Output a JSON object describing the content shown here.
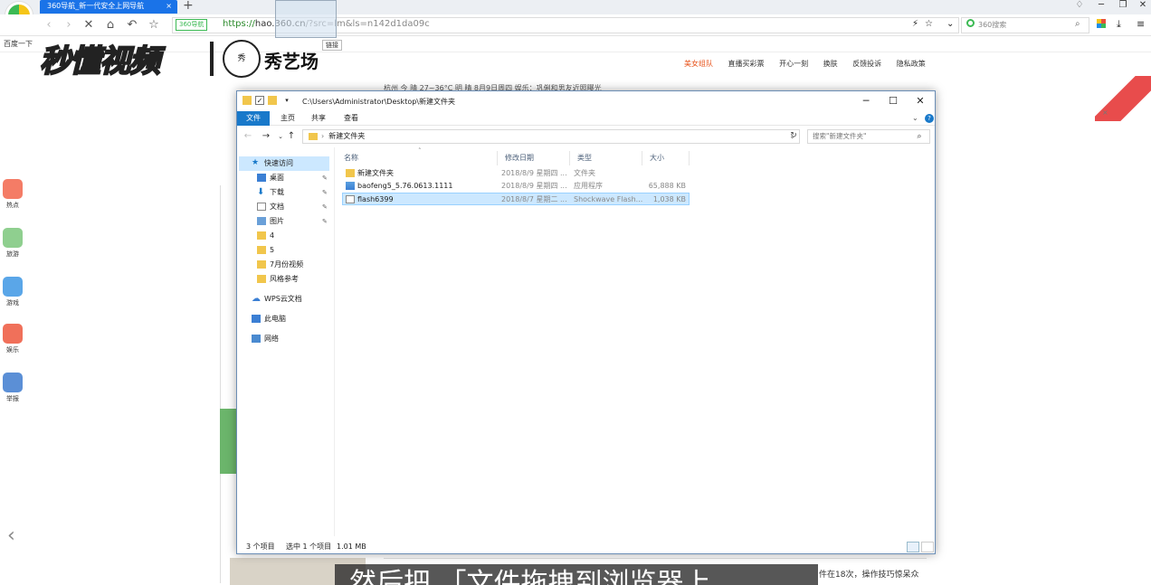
{
  "browser": {
    "tab_title": "360导航_新一代安全上网导航",
    "tab_close": "×",
    "new_tab": "+",
    "badge": "360导航",
    "url_scheme": "https://",
    "url_host": "hao.360.cn",
    "url_path": "/?src=lm&ls=n142d1da09c",
    "search_placeholder": "360搜索",
    "bookmark": "百度一下",
    "drag_link_tip": "链接"
  },
  "watermark": {
    "brand": "秒懂视频",
    "seal": "秀",
    "xiuyi": "秀艺场"
  },
  "page_behind": {
    "links": [
      "美女组队",
      "直播买彩票",
      "开心一刻",
      "换肤",
      "反馈投诉",
      "隐私政策"
    ],
    "weather": "杭州    今 晴 27~36°C    明 晴    8月9日周四    娱乐：巩俐和男友近照曝光",
    "side": [
      "热点",
      "旅游",
      "游戏",
      "娱乐",
      "举报"
    ],
    "news_tail": "件在18次，操作技巧惊呆众",
    "subtitle": "然后把 「文件拖拽到浏览器上"
  },
  "explorer": {
    "title_path": "C:\\Users\\Administrator\\Desktop\\新建文件夹",
    "ribbon_tabs": [
      "文件",
      "主页",
      "共享",
      "查看"
    ],
    "path_crumb": "新建文件夹",
    "search_placeholder": "搜索\"新建文件夹\"",
    "nav_items": [
      "快速访问",
      "桌面",
      "下载",
      "文档",
      "图片",
      "4",
      "5",
      "7月份视频",
      "风格参考",
      "WPS云文档",
      "此电脑",
      "网络"
    ],
    "columns": [
      "名称",
      "修改日期",
      "类型",
      "大小"
    ],
    "files": [
      {
        "name": "新建文件夹",
        "date": "2018/8/9 星期四 ...",
        "type": "文件夹",
        "size": ""
      },
      {
        "name": "baofeng5_5.76.0613.1111",
        "date": "2018/8/9 星期四 ...",
        "type": "应用程序",
        "size": "65,888 KB"
      },
      {
        "name": "flash6399",
        "date": "2018/8/7 星期二 ...",
        "type": "Shockwave Flash...",
        "size": "1,038 KB"
      }
    ],
    "status_count": "3 个项目",
    "status_selected": "选中 1 个项目",
    "status_size": "1.01 MB"
  },
  "colors": {
    "accent": "#1979ca",
    "selection": "#cce8ff",
    "tab": "#1a73e8"
  }
}
